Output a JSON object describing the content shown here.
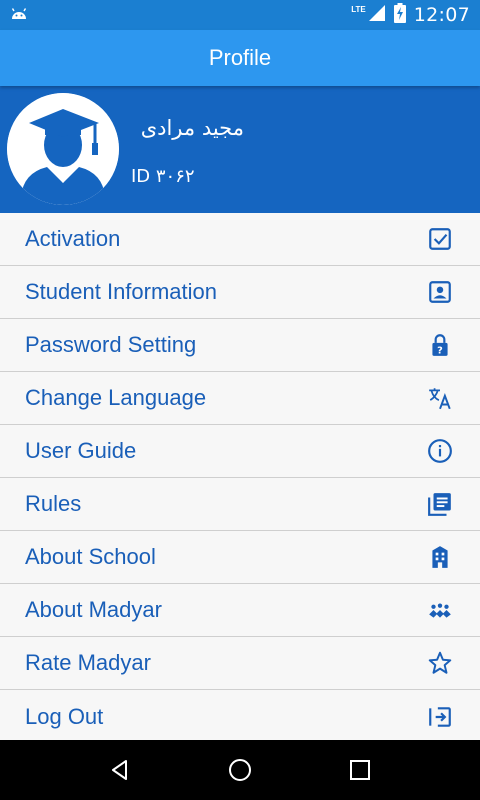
{
  "status_bar": {
    "time": "12:07",
    "network": "LTE",
    "icons": [
      "android-icon",
      "signal-icon",
      "battery-charging-icon"
    ]
  },
  "app_bar": {
    "title": "Profile"
  },
  "profile": {
    "name": "مجید مرادی",
    "id": "ID ۳۰۶۲",
    "avatar_icon": "graduate-avatar-icon"
  },
  "menu": {
    "items": [
      {
        "label": "Activation",
        "icon": "checkbox-icon"
      },
      {
        "label": "Student Information",
        "icon": "contact-card-icon"
      },
      {
        "label": "Password Setting",
        "icon": "lock-icon"
      },
      {
        "label": "Change Language",
        "icon": "translate-icon"
      },
      {
        "label": "User Guide",
        "icon": "info-icon"
      },
      {
        "label": "Rules",
        "icon": "library-books-icon"
      },
      {
        "label": "About School",
        "icon": "school-building-icon"
      },
      {
        "label": "About Madyar",
        "icon": "people-group-icon"
      },
      {
        "label": "Rate Madyar",
        "icon": "star-icon"
      },
      {
        "label": "Log Out",
        "icon": "exit-icon"
      }
    ]
  },
  "nav_bar": {
    "buttons": [
      "back-icon",
      "home-icon",
      "recents-icon"
    ]
  },
  "colors": {
    "status_bar": "#1b7fd1",
    "app_bar": "#2d97ef",
    "profile_header": "#1565c0",
    "menu_text": "#1a5fb8",
    "menu_bg": "#f7f7f7",
    "divider": "#cfcfcf"
  }
}
